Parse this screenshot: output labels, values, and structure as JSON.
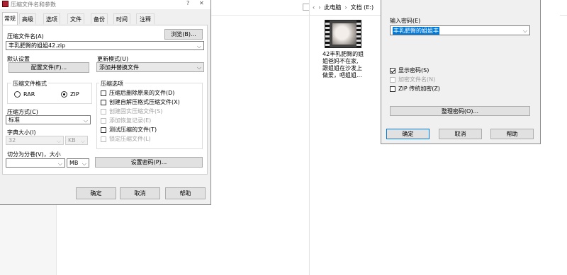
{
  "main_dialog": {
    "title": "压缩文件名和参数",
    "help_glyph": "?",
    "close_glyph": "✕",
    "tabs": [
      "常规",
      "高级",
      "选项",
      "文件",
      "备份",
      "时间",
      "注释"
    ],
    "archive_name_label": "压缩文件名(A)",
    "browse_button": "浏览(B)...",
    "archive_name_value": "丰乳肥臀的姐姐42.zip",
    "default_settings_label": "默认设置",
    "profiles_button": "配置文件(F)...",
    "update_mode_label": "更新模式(U)",
    "update_mode_value": "添加并替换文件",
    "archive_format_label": "压缩文件格式",
    "format_rar": "RAR",
    "format_zip": "ZIP",
    "compression_method_label": "压缩方式(C)",
    "compression_method_value": "标准",
    "dictionary_size_label": "字典大小(I)",
    "dictionary_size_value": "32",
    "dictionary_unit": "KB",
    "split_label": "切分为分卷(V)，大小",
    "split_unit": "MB",
    "set_password_button": "设置密码(P)...",
    "options_label": "压缩选项",
    "options": [
      {
        "label": "压缩后删除原来的文件(D)",
        "checked": false,
        "enabled": true
      },
      {
        "label": "创建自解压格式压缩文件(X)",
        "checked": false,
        "enabled": true
      },
      {
        "label": "创建固实压缩文件(S)",
        "checked": false,
        "enabled": false
      },
      {
        "label": "添加恢复记录(E)",
        "checked": false,
        "enabled": false
      },
      {
        "label": "测试压缩的文件(T)",
        "checked": false,
        "enabled": true
      },
      {
        "label": "锁定压缩文件(L)",
        "checked": false,
        "enabled": false
      }
    ],
    "ok_button": "确定",
    "cancel_button": "取消",
    "help_button": "帮助"
  },
  "explorer": {
    "breadcrumb": [
      "此电脑",
      "文档 (E:)"
    ],
    "file_caption_lines": [
      "42丰乳肥臀的姐",
      "姐爸妈不在家,",
      "跟姐姐在沙发上",
      "做爱，吧姐姐..."
    ]
  },
  "password_dialog": {
    "enter_password_label": "输入密码(E)",
    "password_value": "丰乳肥臀的姐姐丰",
    "show_password_label": "显示密码(S)",
    "show_password_checked": true,
    "encrypt_names_label": "加密文件名(N)",
    "zip_legacy_label": "ZIP 传统加密(Z)",
    "organize_button": "整理密码(O)...",
    "ok_button": "确定",
    "cancel_button": "取消",
    "help_button": "帮助"
  },
  "colors": {
    "accent": "#0078d7",
    "selection": "#0078d7",
    "dialog_bg": "#f0f0f0"
  }
}
